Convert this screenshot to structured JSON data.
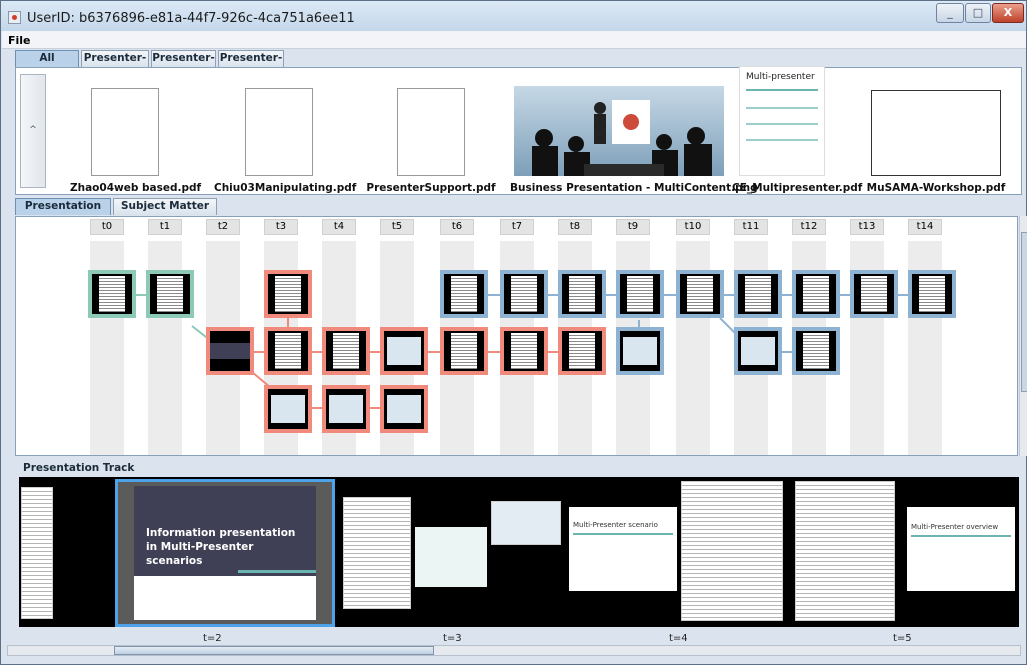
{
  "window": {
    "title": "UserID: b6376896-e81a-44f7-926c-4ca751a6ee11",
    "controls": [
      "_",
      "□",
      "X"
    ]
  },
  "menubar": {
    "file": "File"
  },
  "content_tabs": [
    "All Contents",
    "Presenter-A",
    "Presenter-B",
    "Presenter-C"
  ],
  "contents": {
    "scroll_left": "^",
    "items": [
      {
        "label": "Zhao04web based.pdf",
        "kind": "document"
      },
      {
        "label": "Chiu03Manipulating.pdf",
        "kind": "document"
      },
      {
        "label": "PresenterSupport.pdf",
        "kind": "document"
      },
      {
        "label": "Business Presentation - MultiContent.png",
        "kind": "image"
      },
      {
        "label": "CE_Multipresenter.pdf",
        "kind": "slide",
        "slide_title": "Multi-presenter"
      },
      {
        "label": "MuSAMA-Workshop.pdf",
        "kind": "title-slide",
        "slide_title": "Information presentation in Multi-Presenter scenarios"
      }
    ]
  },
  "view_tabs": [
    "Presentation Graph",
    "Subject Matter View"
  ],
  "graph": {
    "columns": [
      "t0",
      "t1",
      "t2",
      "t3",
      "t4",
      "t5",
      "t6",
      "t7",
      "t8",
      "t9",
      "t10",
      "t11",
      "t12",
      "t13",
      "t14"
    ],
    "legend_colors": {
      "green": "#8ccab7",
      "red": "#f08a7c",
      "blue": "#8eb3d2"
    }
  },
  "track": {
    "title": "Presentation Track",
    "selected_slide": "Information presentation in Multi-Presenter scenarios",
    "slide_scenario": "Multi-Presenter scenario",
    "slide_overview": "Multi-Presenter overview",
    "time_labels": [
      "t=2",
      "t=3",
      "t=4",
      "t=5"
    ]
  }
}
